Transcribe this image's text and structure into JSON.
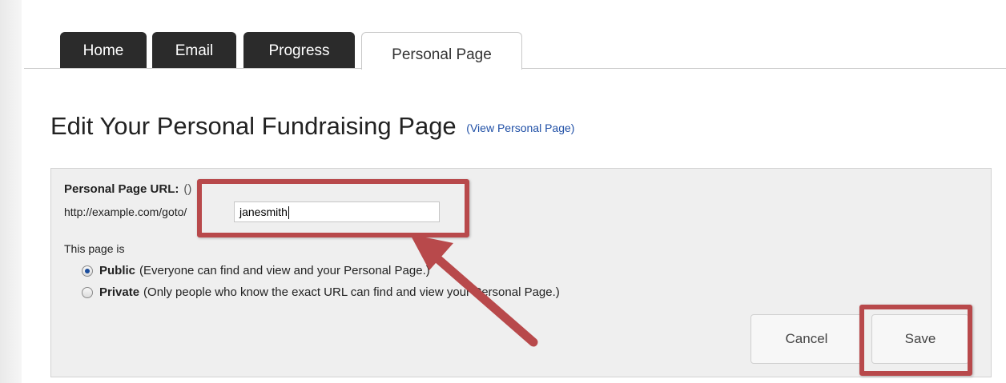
{
  "tabs": [
    {
      "label": "Home"
    },
    {
      "label": "Email"
    },
    {
      "label": "Progress"
    },
    {
      "label": "Personal Page",
      "active": true
    }
  ],
  "page_title": "Edit Your Personal Fundraising Page",
  "view_link": "(View Personal Page)",
  "form": {
    "url_label": "Personal Page URL:",
    "url_hint": "()",
    "url_prefix": "http://example.com/goto/",
    "url_value": "janesmith",
    "visibility_label": "This page is",
    "options": [
      {
        "title": "Public",
        "desc": "(Everyone can find and view and your Personal Page.)",
        "checked": true
      },
      {
        "title": "Private",
        "desc": "(Only people who know the exact URL can find and view your Personal Page.)",
        "checked": false
      }
    ],
    "cancel_label": "Cancel",
    "save_label": "Save"
  },
  "annotation_color": "#b8494b"
}
